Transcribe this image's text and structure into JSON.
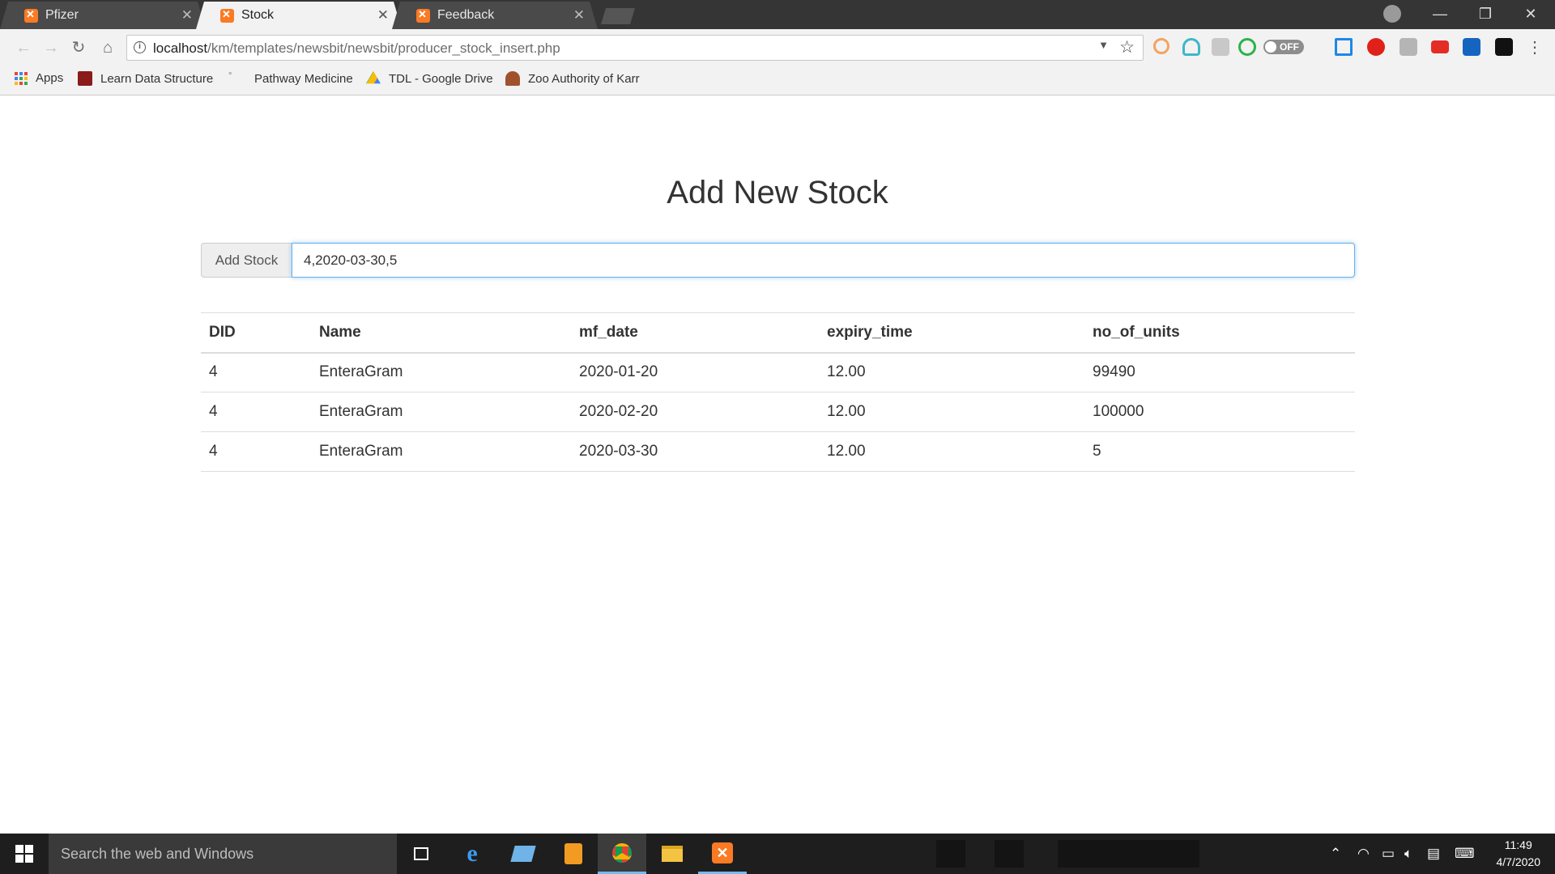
{
  "browser": {
    "tabs": [
      {
        "label": "Pfizer",
        "active": false
      },
      {
        "label": "Stock",
        "active": true
      },
      {
        "label": "Feedback",
        "active": false
      }
    ],
    "url_host": "localhost",
    "url_path": "/km/templates/newsbit/newsbit/producer_stock_insert.php",
    "toggle_label": "OFF",
    "bookmarks": [
      {
        "label": "Apps",
        "icon": "apps-grid-icon"
      },
      {
        "label": "Learn Data Structures",
        "icon": "cc-icon"
      },
      {
        "label": "Pathway Medicine",
        "icon": "pathway-icon"
      },
      {
        "label": "TDL - Google Drive",
        "icon": "google-drive-icon"
      },
      {
        "label": "Zoo Authority of Karr",
        "icon": "zoo-emblem-icon"
      }
    ]
  },
  "page": {
    "title": "Add New Stock",
    "add_stock_label": "Add Stock",
    "stock_input_value": "4,2020-03-30,5",
    "table": {
      "headers": [
        "DID",
        "Name",
        "mf_date",
        "expiry_time",
        "no_of_units"
      ],
      "rows": [
        [
          "4",
          "EnteraGram",
          "2020-01-20",
          "12.00",
          "99490"
        ],
        [
          "4",
          "EnteraGram",
          "2020-02-20",
          "12.00",
          "100000"
        ],
        [
          "4",
          "EnteraGram",
          "2020-03-30",
          "12.00",
          "5"
        ]
      ]
    }
  },
  "taskbar": {
    "search_placeholder": "Search the web and Windows",
    "time": "11:49",
    "date": "4/7/2020"
  },
  "colors": {
    "accent_focus": "#66afe9",
    "xampp_orange": "#fb7a24",
    "taskbar_active": "#76b9ed"
  }
}
